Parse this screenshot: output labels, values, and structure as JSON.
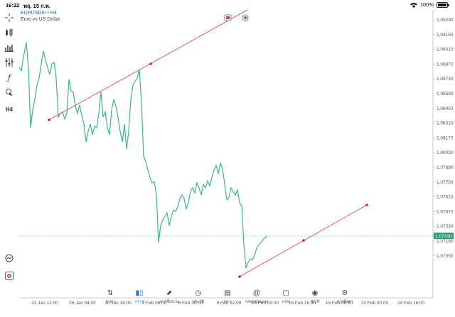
{
  "status_bar": {
    "time": "16:22",
    "date": "พฤ. 15 ก.พ.",
    "battery": "100%"
  },
  "symbol": {
    "name": "EURUSDm • H4",
    "description": "Euro vs US Dollar"
  },
  "price_axis": [
    "1.09290",
    "1.09150",
    "1.09010",
    "1.08870",
    "1.08730",
    "1.08590",
    "1.08450",
    "1.08310",
    "1.08170",
    "1.08030",
    "1.07890",
    "1.07750",
    "1.07610",
    "1.07470",
    "1.07330",
    "1.07190",
    "1.07050"
  ],
  "current_price": "1.07310",
  "time_axis": [
    "23 Jan 12:00",
    "26 Jan 04:00",
    "30 Jan 16:00",
    "2 Feb 08:00",
    "6 Feb 20:00",
    "9 Feb 12:00",
    "14 Feb 00:00",
    "16 Feb 16:00",
    "19 Feb 08:00",
    "22 Feb 00:00",
    "24 Feb 16:00"
  ],
  "colors": {
    "line": "#3bb58c",
    "trend": "#e53935",
    "accent": "#1a73e8",
    "price_tag": "#2e9e6e"
  },
  "toolbar_icons": [
    "crosshair-icon",
    "candles-icon",
    "bar-chart-icon",
    "indicators-icon",
    "function-icon",
    "objects-icon",
    "timeframe-icon"
  ],
  "toolbar_timeframe": "H4",
  "nav": [
    {
      "label": "ราคา",
      "icon": "quotes-icon"
    },
    {
      "label": "กราฟ",
      "icon": "chart-icon"
    },
    {
      "label": "การซื้อขาย",
      "icon": "trade-icon"
    },
    {
      "label": "ประวัติ",
      "icon": "history-icon"
    },
    {
      "label": "ข่าว",
      "icon": "news-icon"
    },
    {
      "label": "กล่องจดหมาย",
      "icon": "mailbox-icon"
    },
    {
      "label": "แชท",
      "icon": "chat-icon"
    },
    {
      "label": "บัญชี",
      "icon": "account-icon"
    },
    {
      "label": "การตั้งค่า",
      "icon": "settings-icon"
    }
  ],
  "nav_active": 1
}
